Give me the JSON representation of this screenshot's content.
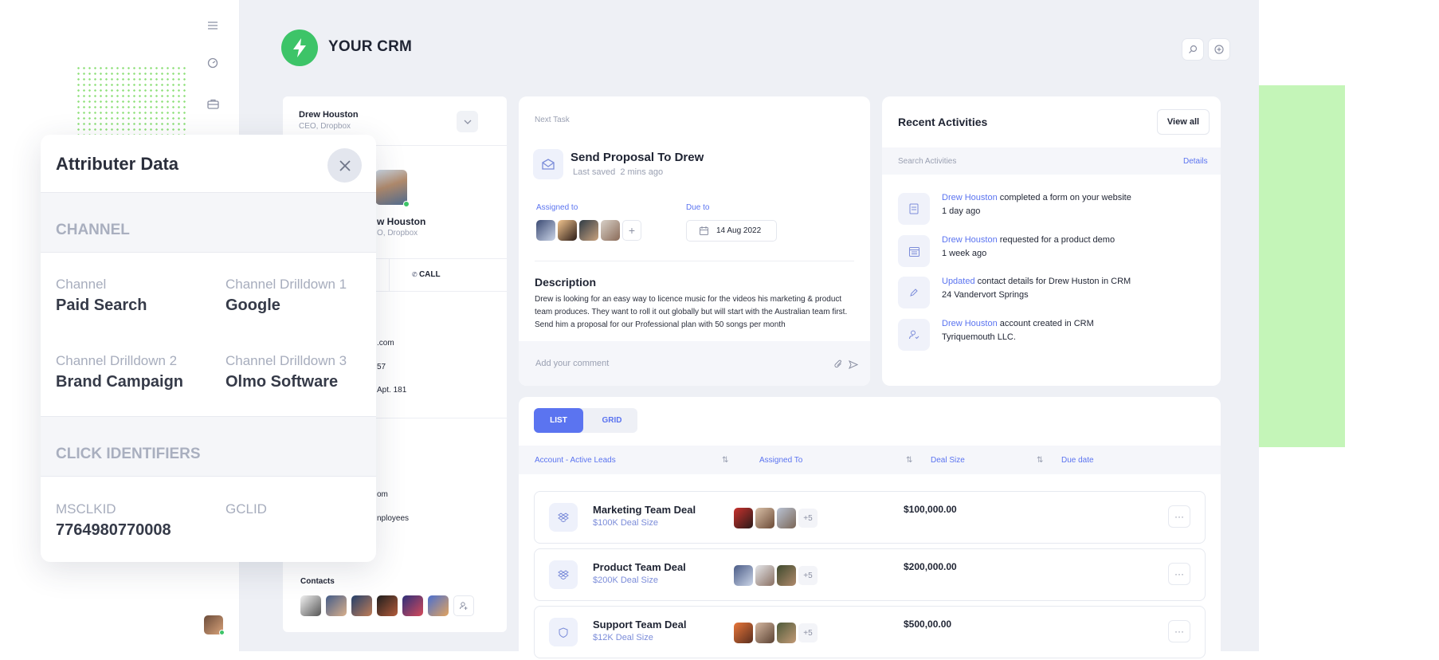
{
  "brand": {
    "name": "YOUR CRM",
    "accent": "#3dc468",
    "link": "#5b74f0"
  },
  "sidebar": {
    "icons": [
      "menu-icon",
      "dashboard-icon",
      "briefcase-icon"
    ]
  },
  "contact": {
    "name": "Drew Houston",
    "role": "CEO, Dropbox",
    "profile_name_partial": "w Houston",
    "profile_role_partial": "O, Dropbox",
    "call_label": "CALL",
    "details": [
      ".com",
      "57",
      "Apt. 181"
    ],
    "company_details": [
      "om",
      "nployees"
    ],
    "contacts_label": "Contacts"
  },
  "task": {
    "header": "Next Task",
    "title": "Send Proposal To Drew",
    "saved": "Last saved  2 mins ago",
    "assigned_label": "Assigned to",
    "due_label": "Due to",
    "due_date": "14 Aug 2022",
    "description_title": "Description",
    "description": "Drew is looking for an easy way to licence music for the videos his marketing & product team produces. They want to roll it out globally but will start with the Australian team first. Send him a proposal for our Professional plan with 50 songs per month",
    "comment_placeholder": "Add your comment"
  },
  "activities": {
    "title": "Recent Activities",
    "view_all": "View all",
    "search_label": "Search Activities",
    "details_link": "Details",
    "items": [
      {
        "link": "Drew Houston",
        "text": " completed a form on your website",
        "sub": "1 day ago"
      },
      {
        "link": "Drew Houston",
        "text": " requested for a product demo",
        "sub": "1 week ago"
      },
      {
        "link": "Updated",
        "text": " contact details for Drew Huston in CRM",
        "sub": "24 Vandervort Springs"
      },
      {
        "link": "Drew Houston",
        "text": " account created in CRM",
        "sub": "Tyriquemouth LLC."
      }
    ]
  },
  "deals": {
    "tabs": {
      "list": "LIST",
      "grid": "GRID"
    },
    "columns": [
      "Account - Active Leads",
      "Assigned To",
      "Deal Size",
      "Due date"
    ],
    "rows": [
      {
        "name": "Marketing Team Deal",
        "sub": "$100K Deal Size",
        "size": "$100,000.00",
        "extra": "+5"
      },
      {
        "name": "Product Team Deal",
        "sub": "$200K Deal Size",
        "size": "$200,000.00",
        "extra": "+5"
      },
      {
        "name": "Support Team Deal",
        "sub": "$12K Deal Size",
        "size": "$500,00.00",
        "extra": "+5"
      }
    ],
    "more": "···"
  },
  "overlay": {
    "title": "Attributer Data",
    "section_channel": "CHANNEL",
    "channel_label": "Channel",
    "channel_value": "Paid Search",
    "drill1_label": "Channel Drilldown 1",
    "drill1_value": "Google",
    "drill2_label": "Channel Drilldown 2",
    "drill2_value": "Brand Campaign",
    "drill3_label": "Channel Drilldown 3",
    "drill3_value": "Olmo Software",
    "section_click": "CLICK IDENTIFIERS",
    "msclkid_label": "MSCLKID",
    "msclkid_value": "7764980770008",
    "gclid_label": "GCLID",
    "gclid_value": ""
  }
}
